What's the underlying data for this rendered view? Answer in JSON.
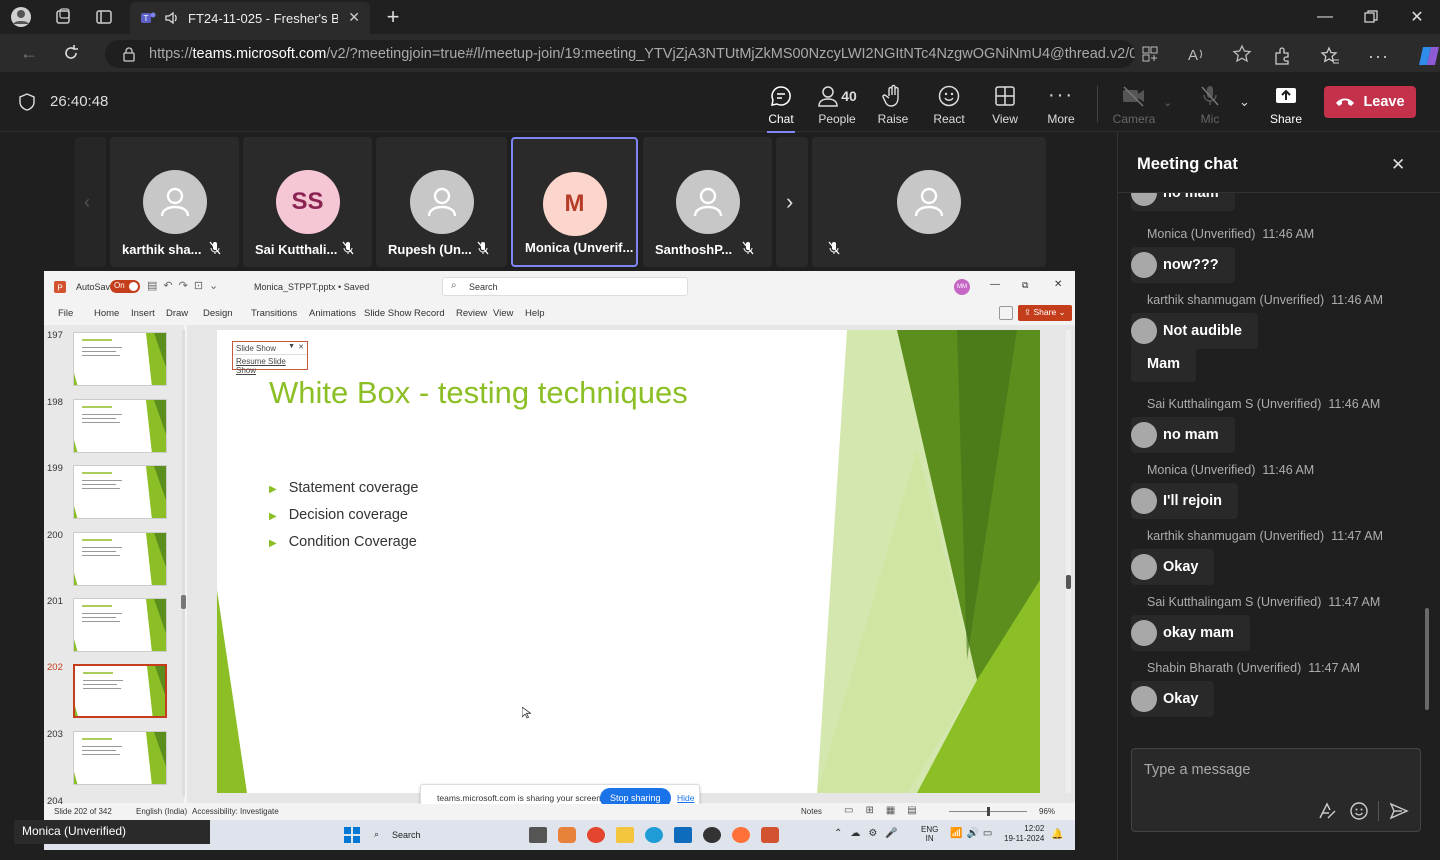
{
  "browser": {
    "tab_title": "FT24-11-025 - Fresher's Batc",
    "url_prefix": "https://",
    "url_host": "teams.microsoft.com",
    "url_rest": "/v2/?meetingjoin=true#/l/meetup-join/19:meeting_YTVjZjA3NTUtMjZkMS00NzcyLWI2NGItNTc4NzgwOGNiNmU4@thread.v2/0?..."
  },
  "meeting": {
    "timer": "26:40:48",
    "tools": {
      "chat": "Chat",
      "people": "People",
      "people_count": "40",
      "raise": "Raise",
      "react": "React",
      "view": "View",
      "more": "More",
      "camera": "Camera",
      "mic": "Mic",
      "share": "Share",
      "leave": "Leave"
    }
  },
  "participants": [
    {
      "name": "karthik sha...",
      "initials": ""
    },
    {
      "name": "Sai Kutthali...",
      "initials": "SS"
    },
    {
      "name": "Rupesh (Un...",
      "initials": ""
    },
    {
      "name": "Monica (Unverif...",
      "initials": "M"
    },
    {
      "name": "SanthoshP...",
      "initials": ""
    },
    {
      "name": "",
      "initials": ""
    }
  ],
  "presenter_label": "Monica (Unverified)",
  "chat": {
    "title": "Meeting chat",
    "input_placeholder": "Type a message",
    "messages": [
      {
        "author": "",
        "time": "",
        "text": "no mam"
      },
      {
        "author": "Monica (Unverified)",
        "time": "11:46 AM",
        "text": "now???"
      },
      {
        "author": "karthik shanmugam (Unverified)",
        "time": "11:46 AM",
        "text": "Not audible"
      },
      {
        "author": "",
        "time": "",
        "text": "Mam"
      },
      {
        "author": "Sai Kutthalingam S (Unverified)",
        "time": "11:46 AM",
        "text": "no mam"
      },
      {
        "author": "Monica (Unverified)",
        "time": "11:46 AM",
        "text": "I'll rejoin"
      },
      {
        "author": "karthik shanmugam (Unverified)",
        "time": "11:47 AM",
        "text": "Okay"
      },
      {
        "author": "Sai Kutthalingam S (Unverified)",
        "time": "11:47 AM",
        "text": "okay mam"
      },
      {
        "author": "Shabin Bharath (Unverified)",
        "time": "11:47 AM",
        "text": "Okay"
      }
    ]
  },
  "ppt": {
    "autosave": "AutoSave",
    "autosave_state": "On",
    "filename": "Monica_STPPT.pptx • Saved",
    "search": "Search",
    "user_initials": "MM",
    "share": "Share",
    "menu": [
      "File",
      "Home",
      "Insert",
      "Draw",
      "Design",
      "Transitions",
      "Animations",
      "Slide Show",
      "Record",
      "Review",
      "View",
      "Help"
    ],
    "slide_numbers": [
      "197",
      "198",
      "199",
      "200",
      "201",
      "202",
      "203",
      "204"
    ],
    "slideshow_popup": "Slide Show",
    "resume": "Resume Slide Show",
    "slide_title": "White Box - testing techniques",
    "bullets": [
      "Statement coverage",
      "Decision coverage",
      "Condition Coverage"
    ],
    "status_slide": "Slide 202 of 342",
    "status_lang": "English (India)",
    "status_access": "Accessibility: Investigate",
    "notes": "Notes",
    "zoom": "96%",
    "sharing_text": "teams.microsoft.com is sharing your screen.",
    "stop_sharing": "Stop sharing",
    "hide": "Hide"
  },
  "taskbar": {
    "search": "Search",
    "lang": "ENG",
    "region": "IN",
    "time": "12:02",
    "date": "19-11-2024"
  },
  "colors": {
    "accent": "#7f85f5",
    "leave": "#c4314b",
    "slide_green": "#8cbf26",
    "ppt_orange": "#d35230"
  }
}
